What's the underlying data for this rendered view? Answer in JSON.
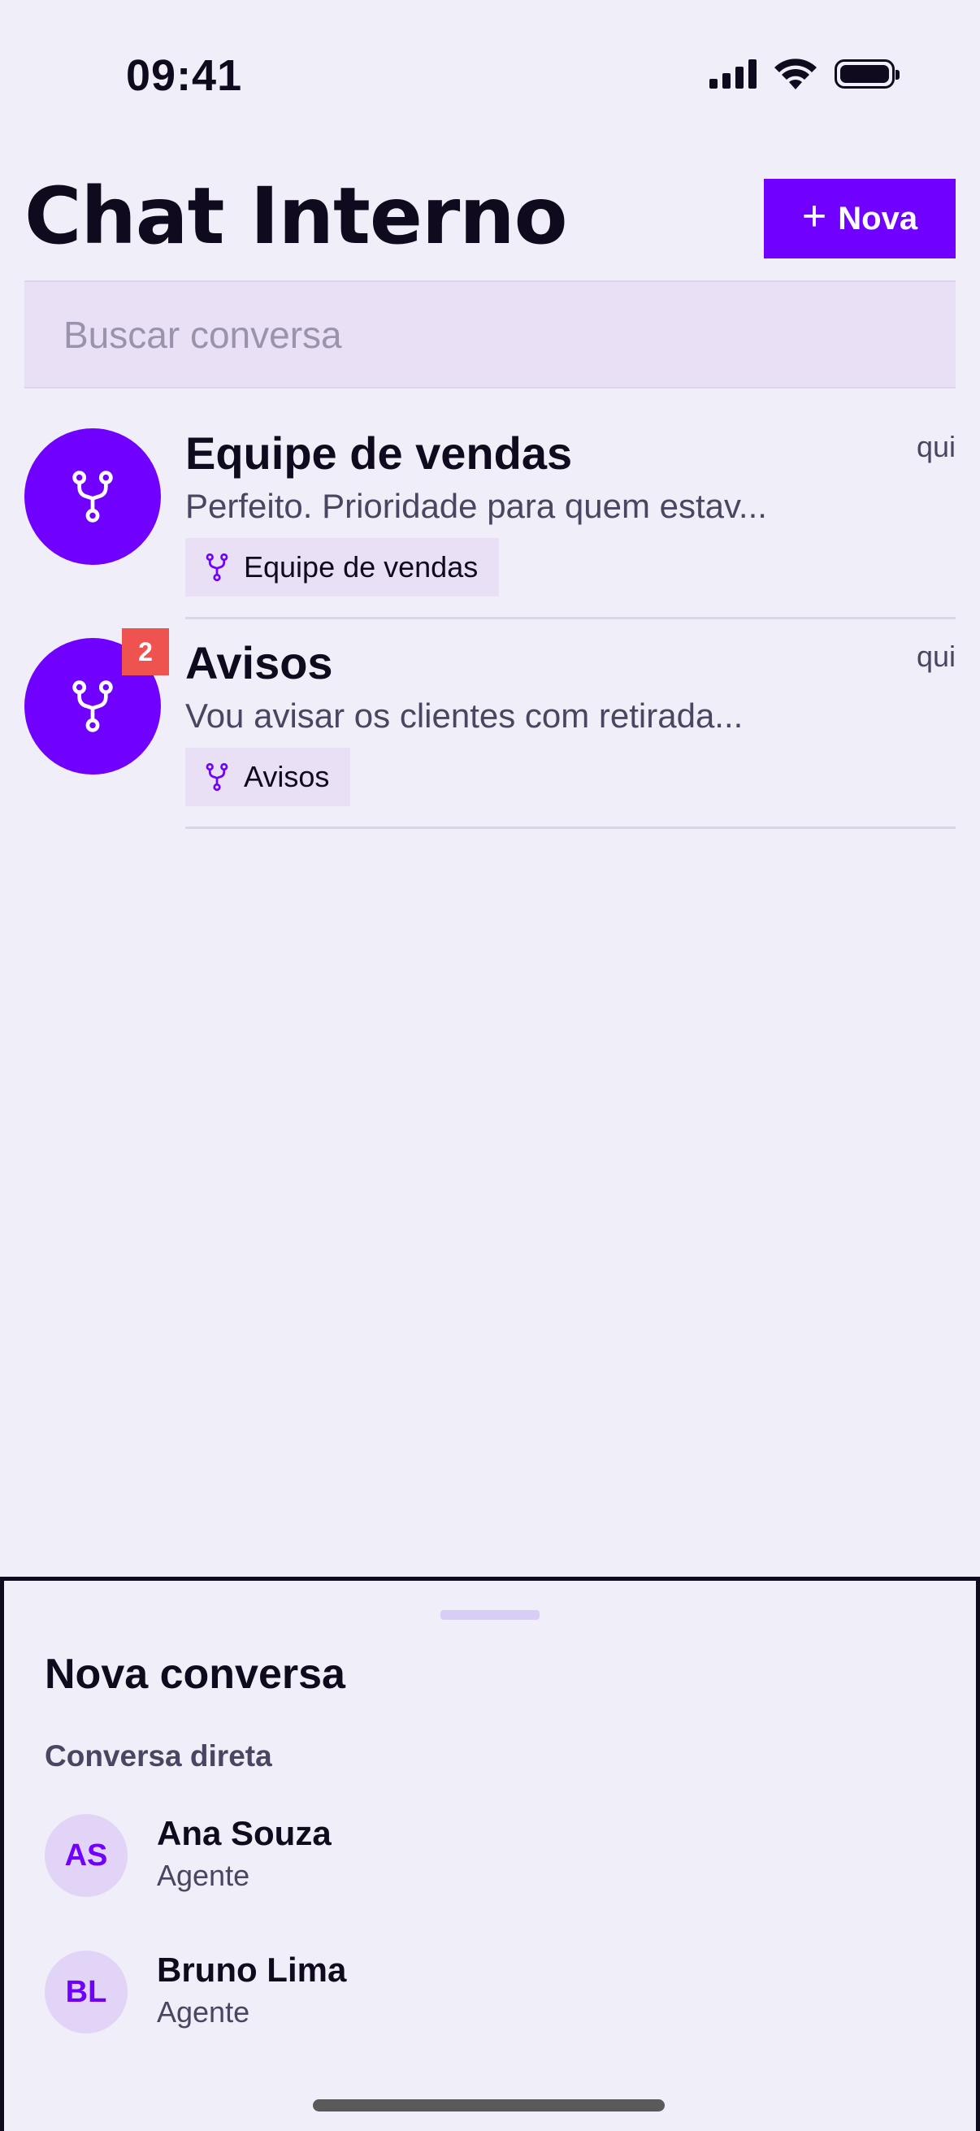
{
  "status_bar": {
    "time": "09:41"
  },
  "header": {
    "title": "Chat Interno",
    "new_button_label": "Nova"
  },
  "search": {
    "placeholder": "Buscar conversa",
    "value": ""
  },
  "conversations": [
    {
      "name": "Equipe de vendas",
      "time": "qui",
      "preview": "Perfeito. Prioridade para quem estav...",
      "tag": "Equipe de vendas",
      "unread": null,
      "icon": "fork-icon"
    },
    {
      "name": "Avisos",
      "time": "qui",
      "preview": "Vou avisar os clientes com retirada...",
      "tag": "Avisos",
      "unread": "2",
      "icon": "fork-icon"
    }
  ],
  "sheet": {
    "title": "Nova conversa",
    "section_label": "Conversa direta",
    "contacts": [
      {
        "initials": "AS",
        "name": "Ana Souza",
        "role": "Agente"
      },
      {
        "initials": "BL",
        "name": "Bruno Lima",
        "role": "Agente"
      }
    ]
  },
  "colors": {
    "accent": "#7000ff",
    "background": "#f0eef8",
    "badge": "#ef5350",
    "tag_background": "#e9e0f6",
    "contact_avatar_bg": "#e2d4f7"
  }
}
